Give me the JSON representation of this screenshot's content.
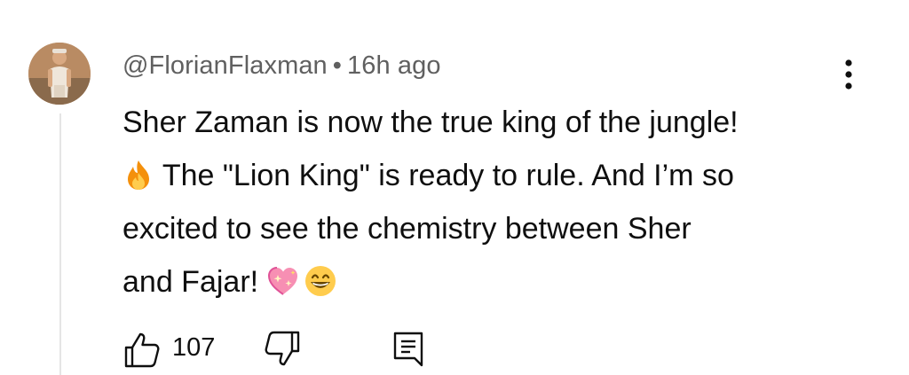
{
  "comment": {
    "author": "@FlorianFlaxman",
    "separator": "•",
    "timestamp": "16h ago",
    "text_lines": [
      "Sher Zaman is now the true king of the jungle!",
      " The \"Lion King\" is ready to rule. And I’m so",
      "excited to see the chemistry between Sher",
      "and Fajar! "
    ],
    "like_count": "107"
  },
  "icons": {
    "avatar": "user-avatar-photo",
    "menu": "more-vert-icon",
    "fire": "fire-emoji",
    "heart": "sparkling-heart-emoji",
    "smile": "grinning-face-emoji",
    "like": "thumbs-up-icon",
    "dislike": "thumbs-down-icon",
    "reply": "reply-comment-icon"
  },
  "colors": {
    "text": "#0f0f0f",
    "meta": "#606060",
    "thread_line": "#e5e5e5"
  }
}
